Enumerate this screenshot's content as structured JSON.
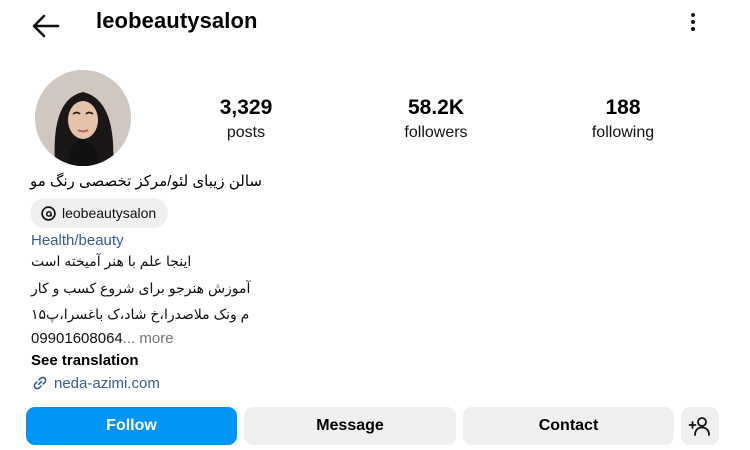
{
  "header": {
    "username": "leobeautysalon",
    "back_icon": "arrow-left-icon",
    "menu_icon": "more-vertical-icon"
  },
  "stats": [
    {
      "value": "3,329",
      "label": "posts"
    },
    {
      "value": "58.2K",
      "label": "followers"
    },
    {
      "value": "188",
      "label": "following"
    }
  ],
  "bio": {
    "full_name": "سالن زیبای لئو/مرکز تخصصی رنگ مو",
    "threads_handle": "leobeautysalon",
    "category": "Health/beauty",
    "line1": "اینجا علم با هنر آمیخته است",
    "line2": "آموزش هنرجو برای شروع کسب و کار",
    "line3": "م ونک ملاصدرا،خ شاد،ک باغسرا،پ۱۵",
    "phone": "09901608064",
    "more_label": "... more",
    "see_translation": "See translation",
    "link": "neda-azimi.com"
  },
  "actions": {
    "follow": "Follow",
    "message": "Message",
    "contact": "Contact",
    "suggest_icon": "add-person-icon"
  },
  "colors": {
    "accent": "#0095f6",
    "link": "#375d8c",
    "button_bg": "#efefef"
  }
}
